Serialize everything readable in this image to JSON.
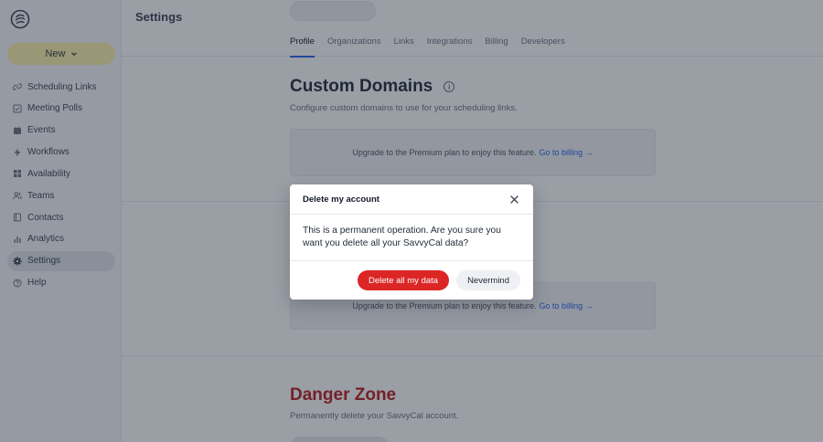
{
  "page": {
    "title": "Settings"
  },
  "sidebar": {
    "new_button": "New",
    "items": [
      {
        "label": "Scheduling Links",
        "icon": "link-icon"
      },
      {
        "label": "Meeting Polls",
        "icon": "checkbox-icon"
      },
      {
        "label": "Events",
        "icon": "calendar-icon"
      },
      {
        "label": "Workflows",
        "icon": "lightning-icon"
      },
      {
        "label": "Availability",
        "icon": "grid-icon"
      },
      {
        "label": "Teams",
        "icon": "users-icon"
      },
      {
        "label": "Contacts",
        "icon": "book-icon"
      },
      {
        "label": "Analytics",
        "icon": "bar-chart-icon"
      },
      {
        "label": "Settings",
        "icon": "gear-icon",
        "active": true
      },
      {
        "label": "Help",
        "icon": "question-icon"
      }
    ]
  },
  "tabs": [
    "Profile",
    "Organizations",
    "Links",
    "Integrations",
    "Billing",
    "Developers"
  ],
  "active_tab": "Profile",
  "custom_domains": {
    "title": "Custom Domains",
    "description": "Configure custom domains to use for your scheduling links.",
    "upgrade_text": "Upgrade to the Premium plan to enjoy this feature.",
    "billing_link": "Go to billing →"
  },
  "second_section": {
    "upgrade_text": "Upgrade to the Premium plan to enjoy this feature.",
    "billing_link": "Go to billing →"
  },
  "danger_zone": {
    "title": "Danger Zone",
    "description": "Permanently delete your SavvyCal account."
  },
  "modal": {
    "title": "Delete my account",
    "body": "This is a permanent operation. Are you sure you want you delete all your SavvyCal data?",
    "confirm_label": "Delete all my data",
    "cancel_label": "Nevermind"
  },
  "colors": {
    "accent": "#2563eb",
    "new_button": "#fff3ac",
    "danger": "#dc2626"
  }
}
